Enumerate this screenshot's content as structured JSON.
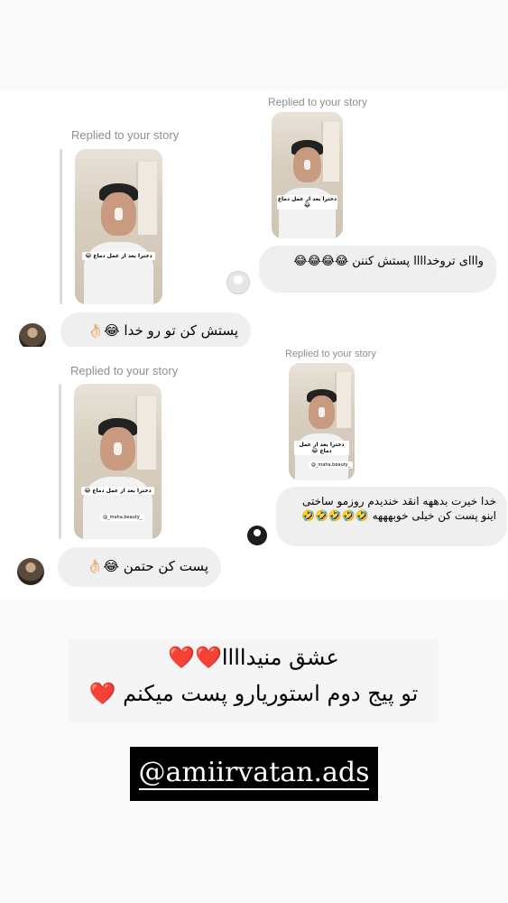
{
  "conversation_1": {
    "outgoing_reply_label": "Replied to your story",
    "incoming_reply_label": "Replied to your story",
    "outgoing_message": "وااای تروخداااا پستش کننن 😂😂😂😂",
    "incoming_message": "پستش کن تو رو خدا 😂👌🏻",
    "story_caption": "دخترا بعد از عمل دماغ 😂"
  },
  "conversation_2": {
    "outgoing_reply_label": "Replied to your story",
    "incoming_reply_label": "Replied to your story",
    "outgoing_message": "خدا خیرت بدههه انقد خندیدم روزمو ساختی اینو پست کن خیلی خوبهههه 🤣🤣🤣🤣🤣",
    "incoming_message": "پست کن حتمن 😂👌🏻",
    "story_caption": "دخترا بعد از عمل دماغ 😂",
    "story_tag": "@_maha.beauty_"
  },
  "caption": {
    "line1": "عشق منیداااا❤️❤️",
    "line2": "تو پیج دوم استوریارو پست میکنم ❤️"
  },
  "handle": "@amiirvatan.ads"
}
